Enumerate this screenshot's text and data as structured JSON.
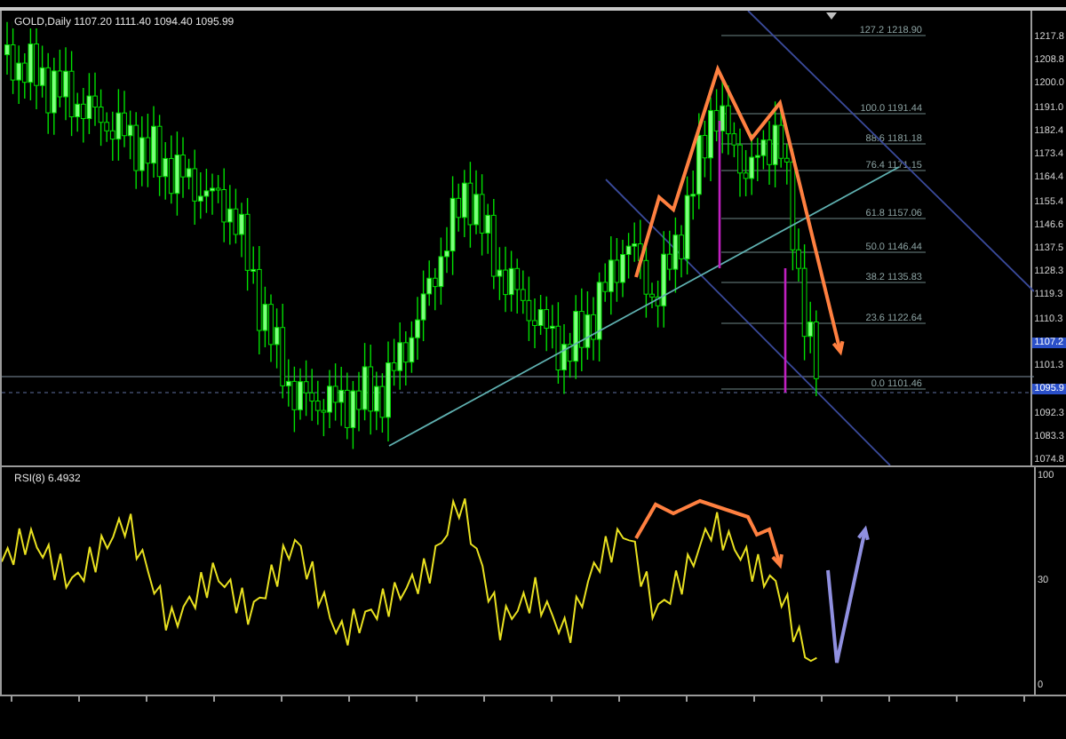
{
  "chart": {
    "title": "GOLD,Daily  1107.20 1111.40 1094.40 1095.99",
    "price_axis": [
      "1217.8",
      "1208.8",
      "1200.0",
      "1191.0",
      "1182.4",
      "1173.4",
      "1164.4",
      "1155.4",
      "1146.6",
      "1137.5",
      "1128.3",
      "1119.3",
      "1110.3",
      "1101.3",
      "1092.3",
      "1083.3",
      "1074.8"
    ],
    "price_markers": [
      "1107.2",
      "1095.9"
    ],
    "fib_levels": [
      {
        "label": "127.2 1218.90"
      },
      {
        "label": "100.0 1191.44"
      },
      {
        "label": "88.6 1181.18"
      },
      {
        "label": "76.4 1171.15"
      },
      {
        "label": "61.8 1157.06"
      },
      {
        "label": "50.0 1146.44"
      },
      {
        "label": "38.2 1135.83"
      },
      {
        "label": "23.6 1122.64"
      },
      {
        "label": "0.0 1101.46"
      }
    ]
  },
  "indicator": {
    "label": "RSI(8) 6.4932",
    "axis": [
      "100",
      "30",
      "0"
    ]
  }
}
